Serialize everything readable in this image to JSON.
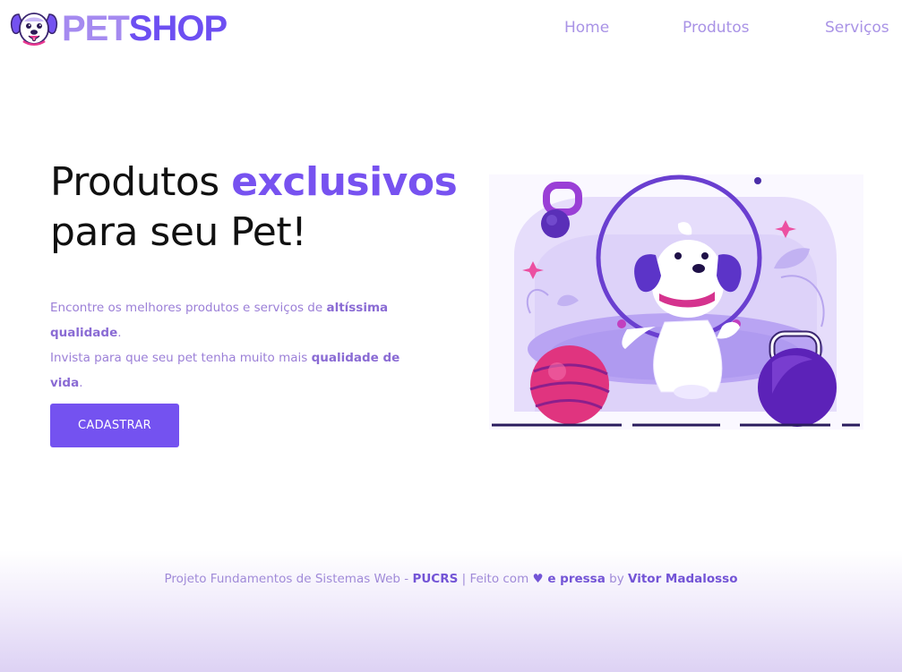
{
  "header": {
    "brand_part1": "PET",
    "brand_part2": "SHOP",
    "nav": [
      {
        "label": "Home"
      },
      {
        "label": "Produtos"
      },
      {
        "label": "Serviços"
      }
    ]
  },
  "hero": {
    "title_part1": "Produtos ",
    "title_highlight": "exclusivos",
    "title_line2": "para seu Pet!",
    "text_part1": "Encontre os melhores produtos e serviços de ",
    "text_bold1": "altíssima qualidade",
    "text_part2": ".",
    "text_part3": "Invista para que seu pet tenha muito mais ",
    "text_bold2": "qualidade de vida",
    "text_part4": ".",
    "button_label": "CADASTRAR"
  },
  "footer": {
    "text1": "Projeto Fundamentos de Sistemas Web - ",
    "bold1": "PUCRS",
    "text2": " | Feito com ",
    "bold2": "♥ e pressa",
    "text3": " by ",
    "bold3": "Vitor Madalosso"
  },
  "icons": {
    "logo": "dog-face-icon",
    "illustration": "dog-jumping-illustration"
  },
  "colors": {
    "accent": "#7452f0",
    "accent_light": "#a58af0",
    "text_muted": "#9b7fd7",
    "pink": "#e8368f"
  }
}
